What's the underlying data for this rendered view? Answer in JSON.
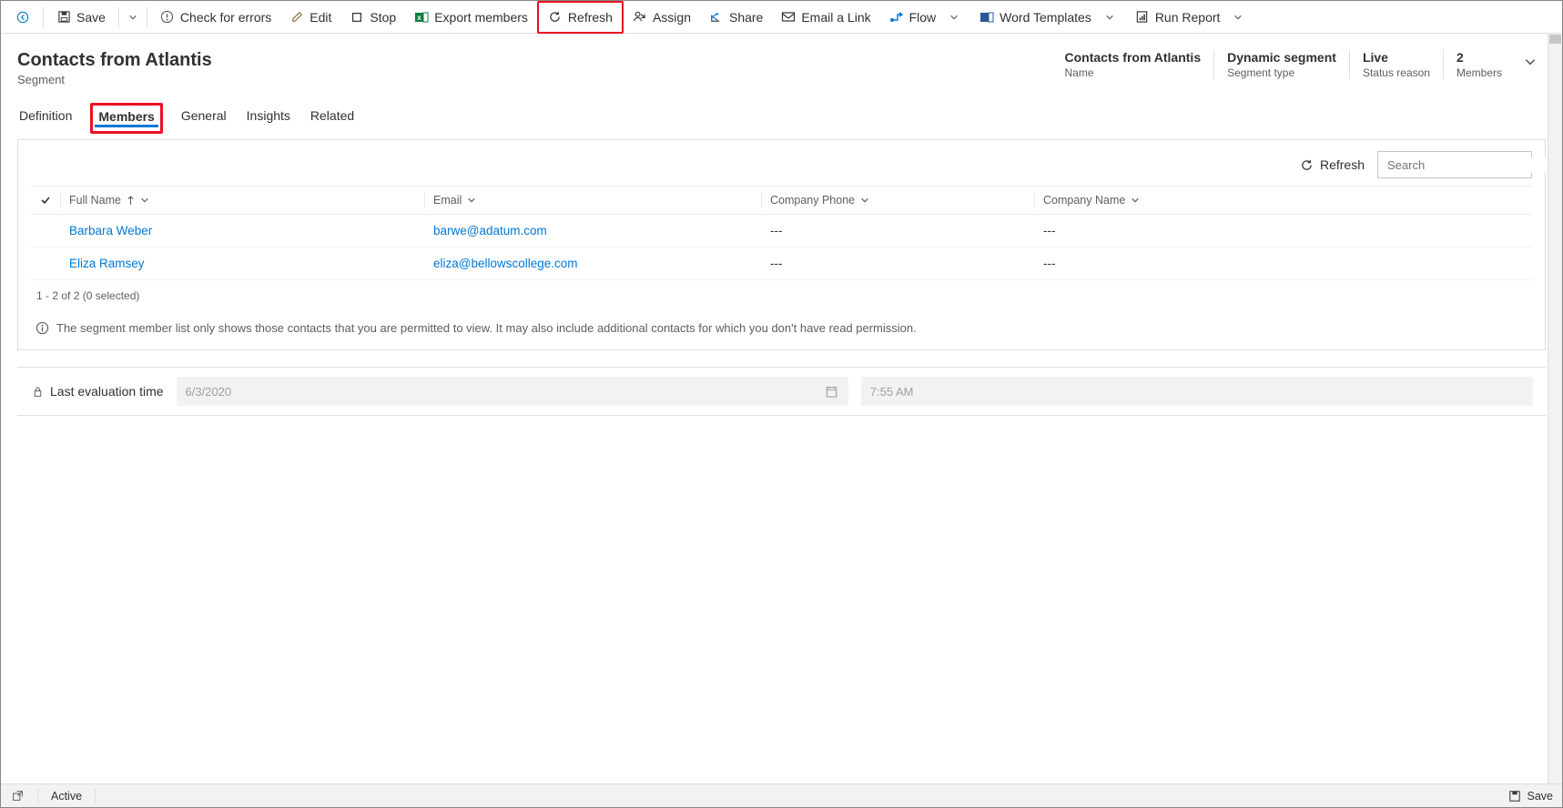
{
  "commandBar": {
    "save": "Save",
    "checkErrors": "Check for errors",
    "edit": "Edit",
    "stop": "Stop",
    "exportMembers": "Export members",
    "refresh": "Refresh",
    "assign": "Assign",
    "share": "Share",
    "emailLink": "Email a Link",
    "flow": "Flow",
    "wordTemplates": "Word Templates",
    "runReport": "Run Report"
  },
  "header": {
    "title": "Contacts from Atlantis",
    "subtitle": "Segment",
    "stats": [
      {
        "value": "Contacts from Atlantis",
        "label": "Name"
      },
      {
        "value": "Dynamic segment",
        "label": "Segment type"
      },
      {
        "value": "Live",
        "label": "Status reason"
      },
      {
        "value": "2",
        "label": "Members"
      }
    ]
  },
  "tabs": {
    "definition": "Definition",
    "members": "Members",
    "general": "General",
    "insights": "Insights",
    "related": "Related"
  },
  "membersPanel": {
    "refresh": "Refresh",
    "searchPlaceholder": "Search",
    "columns": {
      "fullName": "Full Name",
      "email": "Email",
      "companyPhone": "Company Phone",
      "companyName": "Company Name"
    },
    "rows": [
      {
        "name": "Barbara Weber",
        "email": "barwe@adatum.com",
        "phone": "---",
        "company": "---"
      },
      {
        "name": "Eliza Ramsey",
        "email": "eliza@bellowscollege.com",
        "phone": "---",
        "company": "---"
      }
    ],
    "pager": "1 - 2 of 2 (0 selected)",
    "info": "The segment member list only shows those contacts that you are permitted to view. It may also include additional contacts for which you don't have read permission."
  },
  "evaluation": {
    "label": "Last evaluation time",
    "date": "6/3/2020",
    "time": "7:55 AM"
  },
  "statusBar": {
    "status": "Active",
    "save": "Save"
  }
}
